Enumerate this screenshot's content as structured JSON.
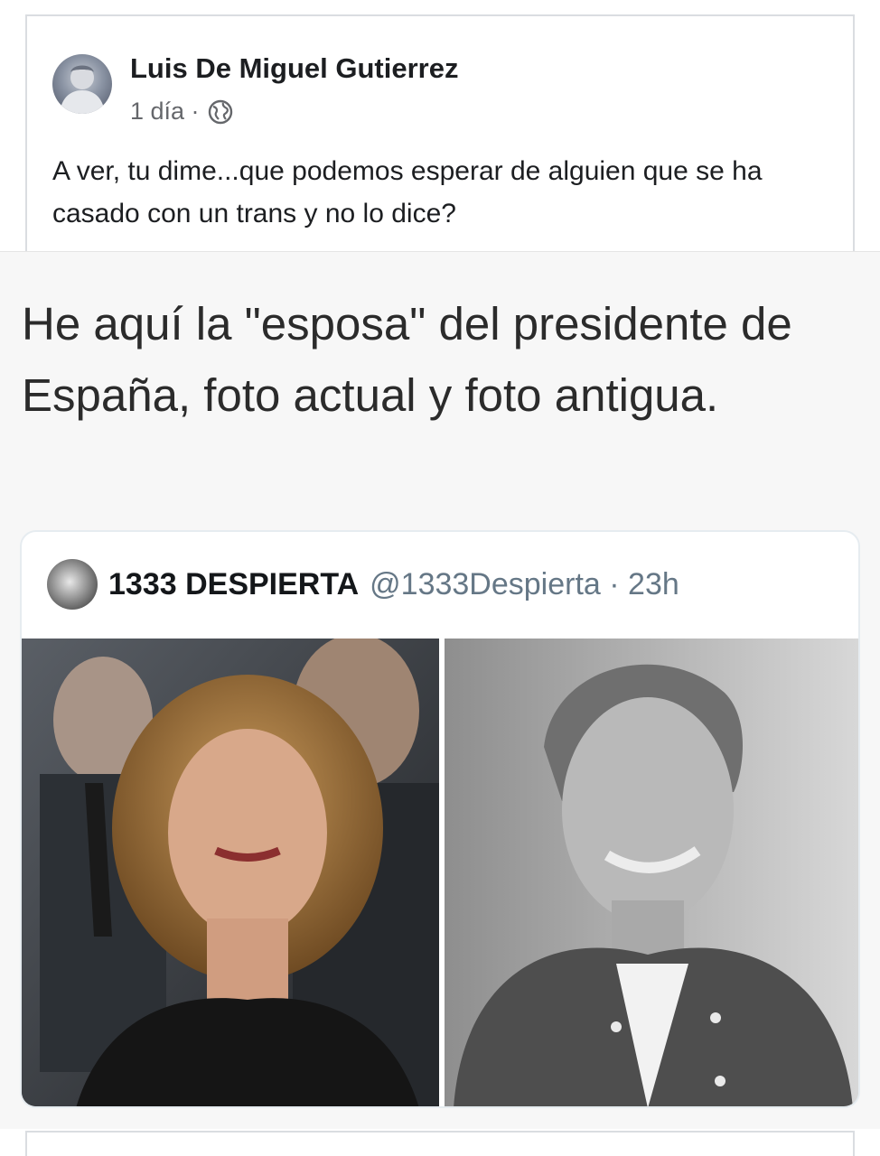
{
  "post": {
    "author": "Luis De Miguel Gutierrez",
    "time": "1 día ·",
    "privacy_icon": "globe-icon",
    "text": "A ver, tu dime...que podemos esperar de alguien que se ha casado con un trans y no lo dice?"
  },
  "shared_image": {
    "headline": "He aquí la \"esposa\" del presidente de España, foto actual y foto antigua.",
    "tweet": {
      "name": "1333 DESPIERTA",
      "handle": "@1333Despierta · 23h"
    }
  },
  "colors": {
    "text_primary": "#1c1e21",
    "text_secondary": "#65676b",
    "card_border": "#dadde1",
    "tweet_handle": "#657786"
  }
}
